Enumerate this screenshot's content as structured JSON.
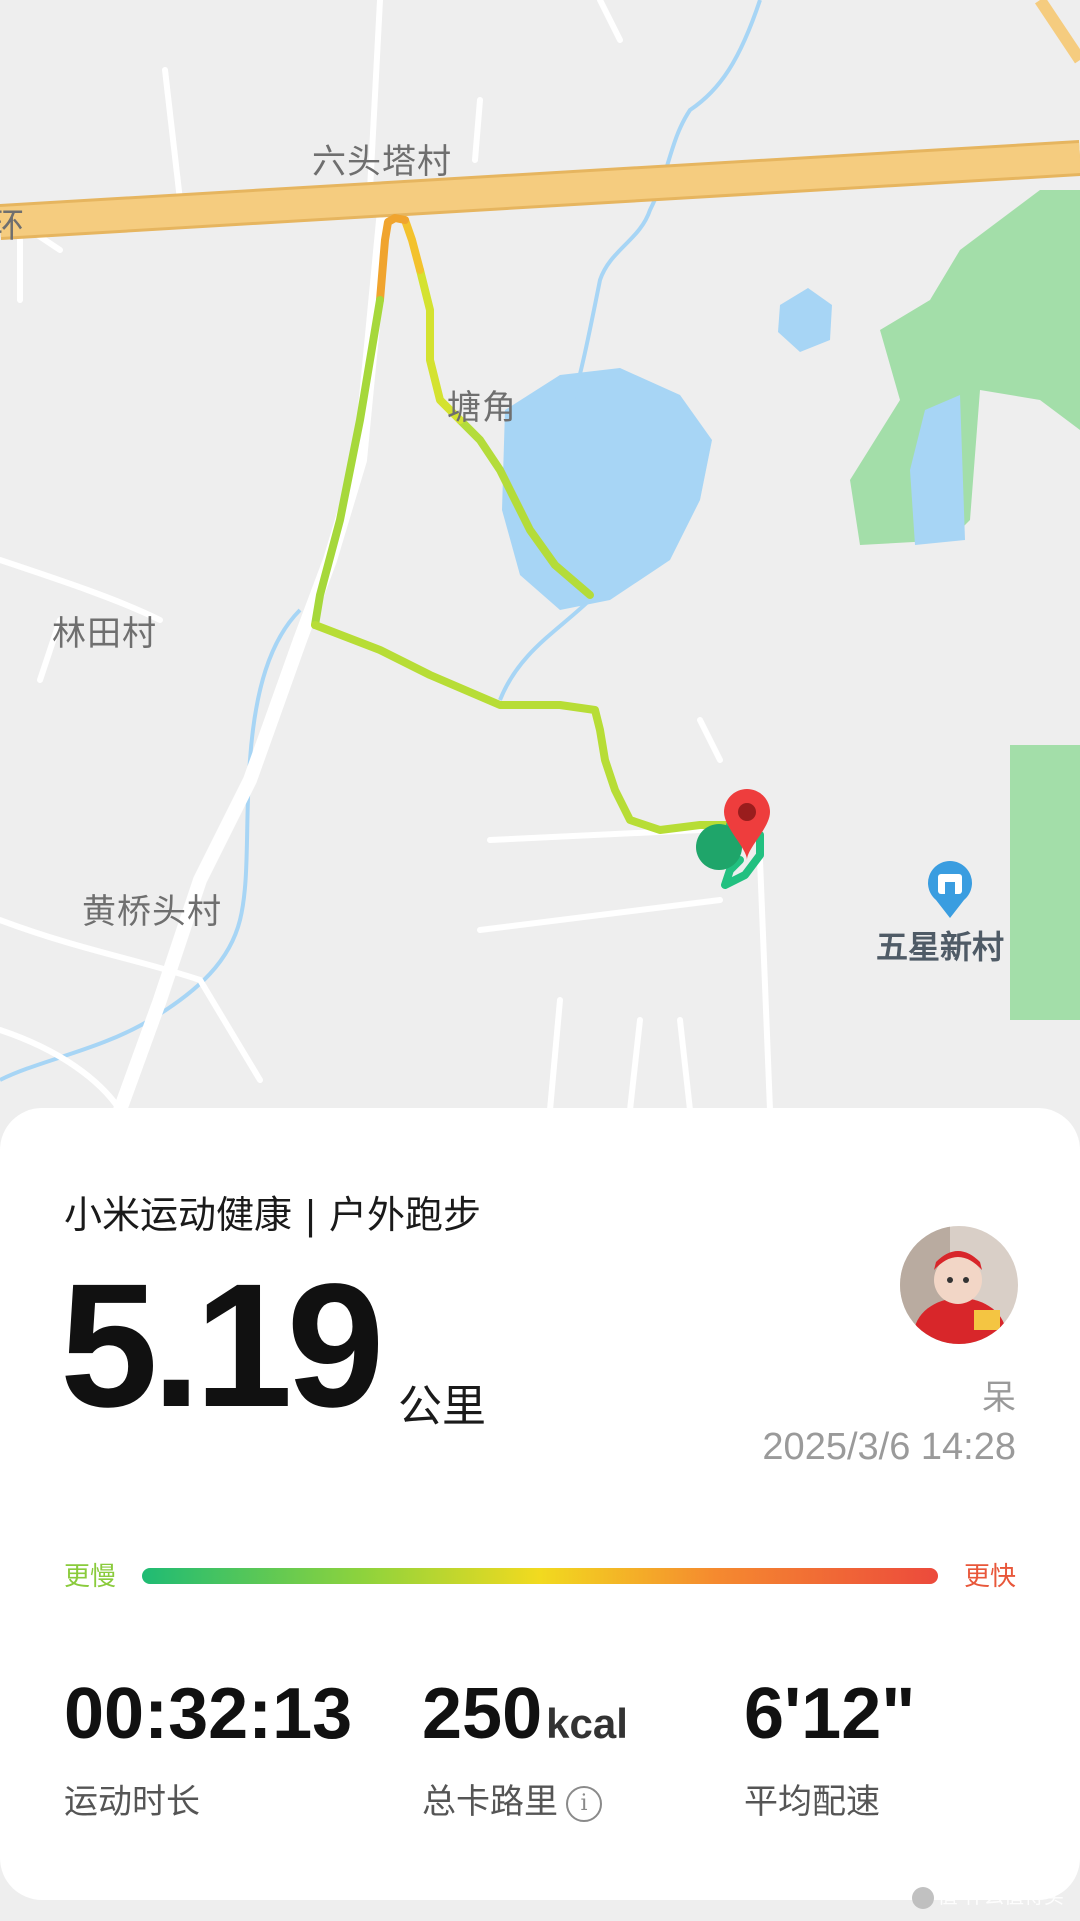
{
  "map": {
    "labels": {
      "ring_road": "环",
      "liutouta": "六头塔村",
      "tangjiao": "塘角",
      "lintian": "林田村",
      "huangqiaotou": "黄桥头村",
      "wuxing": "五星新村"
    },
    "colors": {
      "background": "#eeeeee",
      "water": "#a7d5f5",
      "green": "#a3dea9",
      "road_main": "#f5cc7f",
      "road_minor": "#ffffff"
    }
  },
  "workout": {
    "title": "小米运动健康 | 户外跑步",
    "distance": "5.19",
    "distance_unit": "公里",
    "user_name": "呆",
    "datetime": "2025/3/6 14:28"
  },
  "pace_legend": {
    "slow_label": "更慢",
    "fast_label": "更快",
    "colors": [
      "#1fbb74",
      "#8fd33c",
      "#f2da1f",
      "#f58a2f",
      "#ec4a3c"
    ]
  },
  "stats": {
    "duration": {
      "value": "00:32:13",
      "label": "运动时长"
    },
    "calories": {
      "value": "250",
      "unit": "kcal",
      "label": "总卡路里"
    },
    "pace": {
      "value": "6'12\"",
      "label": "平均配速"
    }
  },
  "watermark": "值 什么值得买"
}
